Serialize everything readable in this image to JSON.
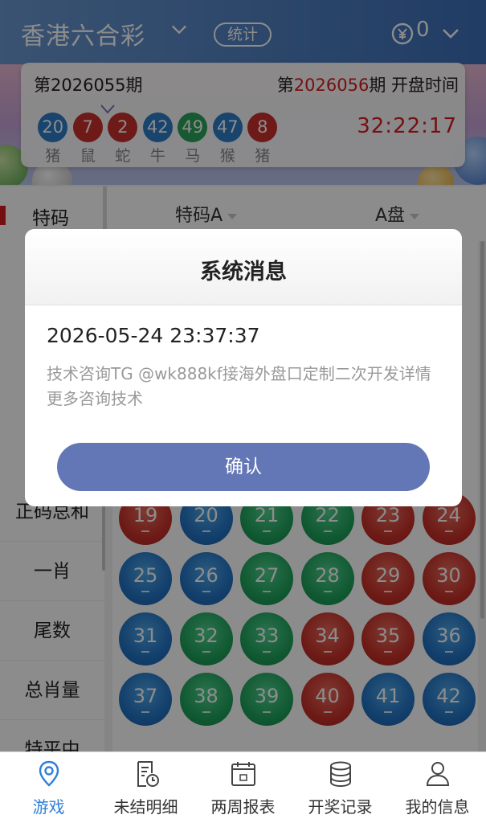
{
  "header": {
    "title": "香港六合彩",
    "stat_label": "统计",
    "balance": "0",
    "accent": "#3d6fb8"
  },
  "draw": {
    "prev_label": "第2026055期",
    "next_prefix": "第",
    "next_issue": "2026056",
    "next_suffix": "期 开盘时间",
    "countdown": "32:22:17",
    "balls": [
      {
        "num": "20",
        "zodiac": "猪",
        "color": "blue"
      },
      {
        "num": "7",
        "zodiac": "鼠",
        "color": "red"
      },
      {
        "num": "2",
        "zodiac": "蛇",
        "color": "red"
      },
      {
        "num": "42",
        "zodiac": "牛",
        "color": "blue"
      },
      {
        "num": "49",
        "zodiac": "马",
        "color": "green"
      },
      {
        "num": "47",
        "zodiac": "猴",
        "color": "blue"
      },
      {
        "num": "8",
        "zodiac": "猪",
        "color": "red"
      }
    ]
  },
  "tabs": {
    "side_active": "特码",
    "dropdown1": "特码A",
    "dropdown2": "A盘"
  },
  "leftnav": {
    "items": [
      "正码总和",
      "一肖",
      "尾数",
      "总肖量",
      "特平中"
    ]
  },
  "grid": {
    "rows": [
      [
        {
          "n": "19",
          "c": "red"
        },
        {
          "n": "20",
          "c": "blue"
        },
        {
          "n": "21",
          "c": "green"
        },
        {
          "n": "22",
          "c": "green"
        },
        {
          "n": "23",
          "c": "red"
        },
        {
          "n": "24",
          "c": "red"
        }
      ],
      [
        {
          "n": "25",
          "c": "blue"
        },
        {
          "n": "26",
          "c": "blue"
        },
        {
          "n": "27",
          "c": "green"
        },
        {
          "n": "28",
          "c": "green"
        },
        {
          "n": "29",
          "c": "red"
        },
        {
          "n": "30",
          "c": "red"
        }
      ],
      [
        {
          "n": "31",
          "c": "blue"
        },
        {
          "n": "32",
          "c": "green"
        },
        {
          "n": "33",
          "c": "green"
        },
        {
          "n": "34",
          "c": "red"
        },
        {
          "n": "35",
          "c": "red"
        },
        {
          "n": "36",
          "c": "blue"
        }
      ],
      [
        {
          "n": "37",
          "c": "blue"
        },
        {
          "n": "38",
          "c": "green"
        },
        {
          "n": "39",
          "c": "green"
        },
        {
          "n": "40",
          "c": "red"
        },
        {
          "n": "41",
          "c": "blue"
        },
        {
          "n": "42",
          "c": "blue"
        }
      ]
    ]
  },
  "dialog": {
    "title": "系统消息",
    "datetime": "2026-05-24 23:37:37",
    "message": "技术咨询TG @wk888kf接海外盘口定制二次开发详情更多咨询技术",
    "confirm_label": "确认",
    "button_color": "#6376b6"
  },
  "bottombar": {
    "items": [
      {
        "label": "游戏",
        "icon": "location-pin-icon",
        "active": true
      },
      {
        "label": "未结明细",
        "icon": "document-clock-icon",
        "active": false
      },
      {
        "label": "两周报表",
        "icon": "calendar-icon",
        "active": false
      },
      {
        "label": "开奖记录",
        "icon": "database-icon",
        "active": false
      },
      {
        "label": "我的信息",
        "icon": "user-icon",
        "active": false
      }
    ]
  }
}
